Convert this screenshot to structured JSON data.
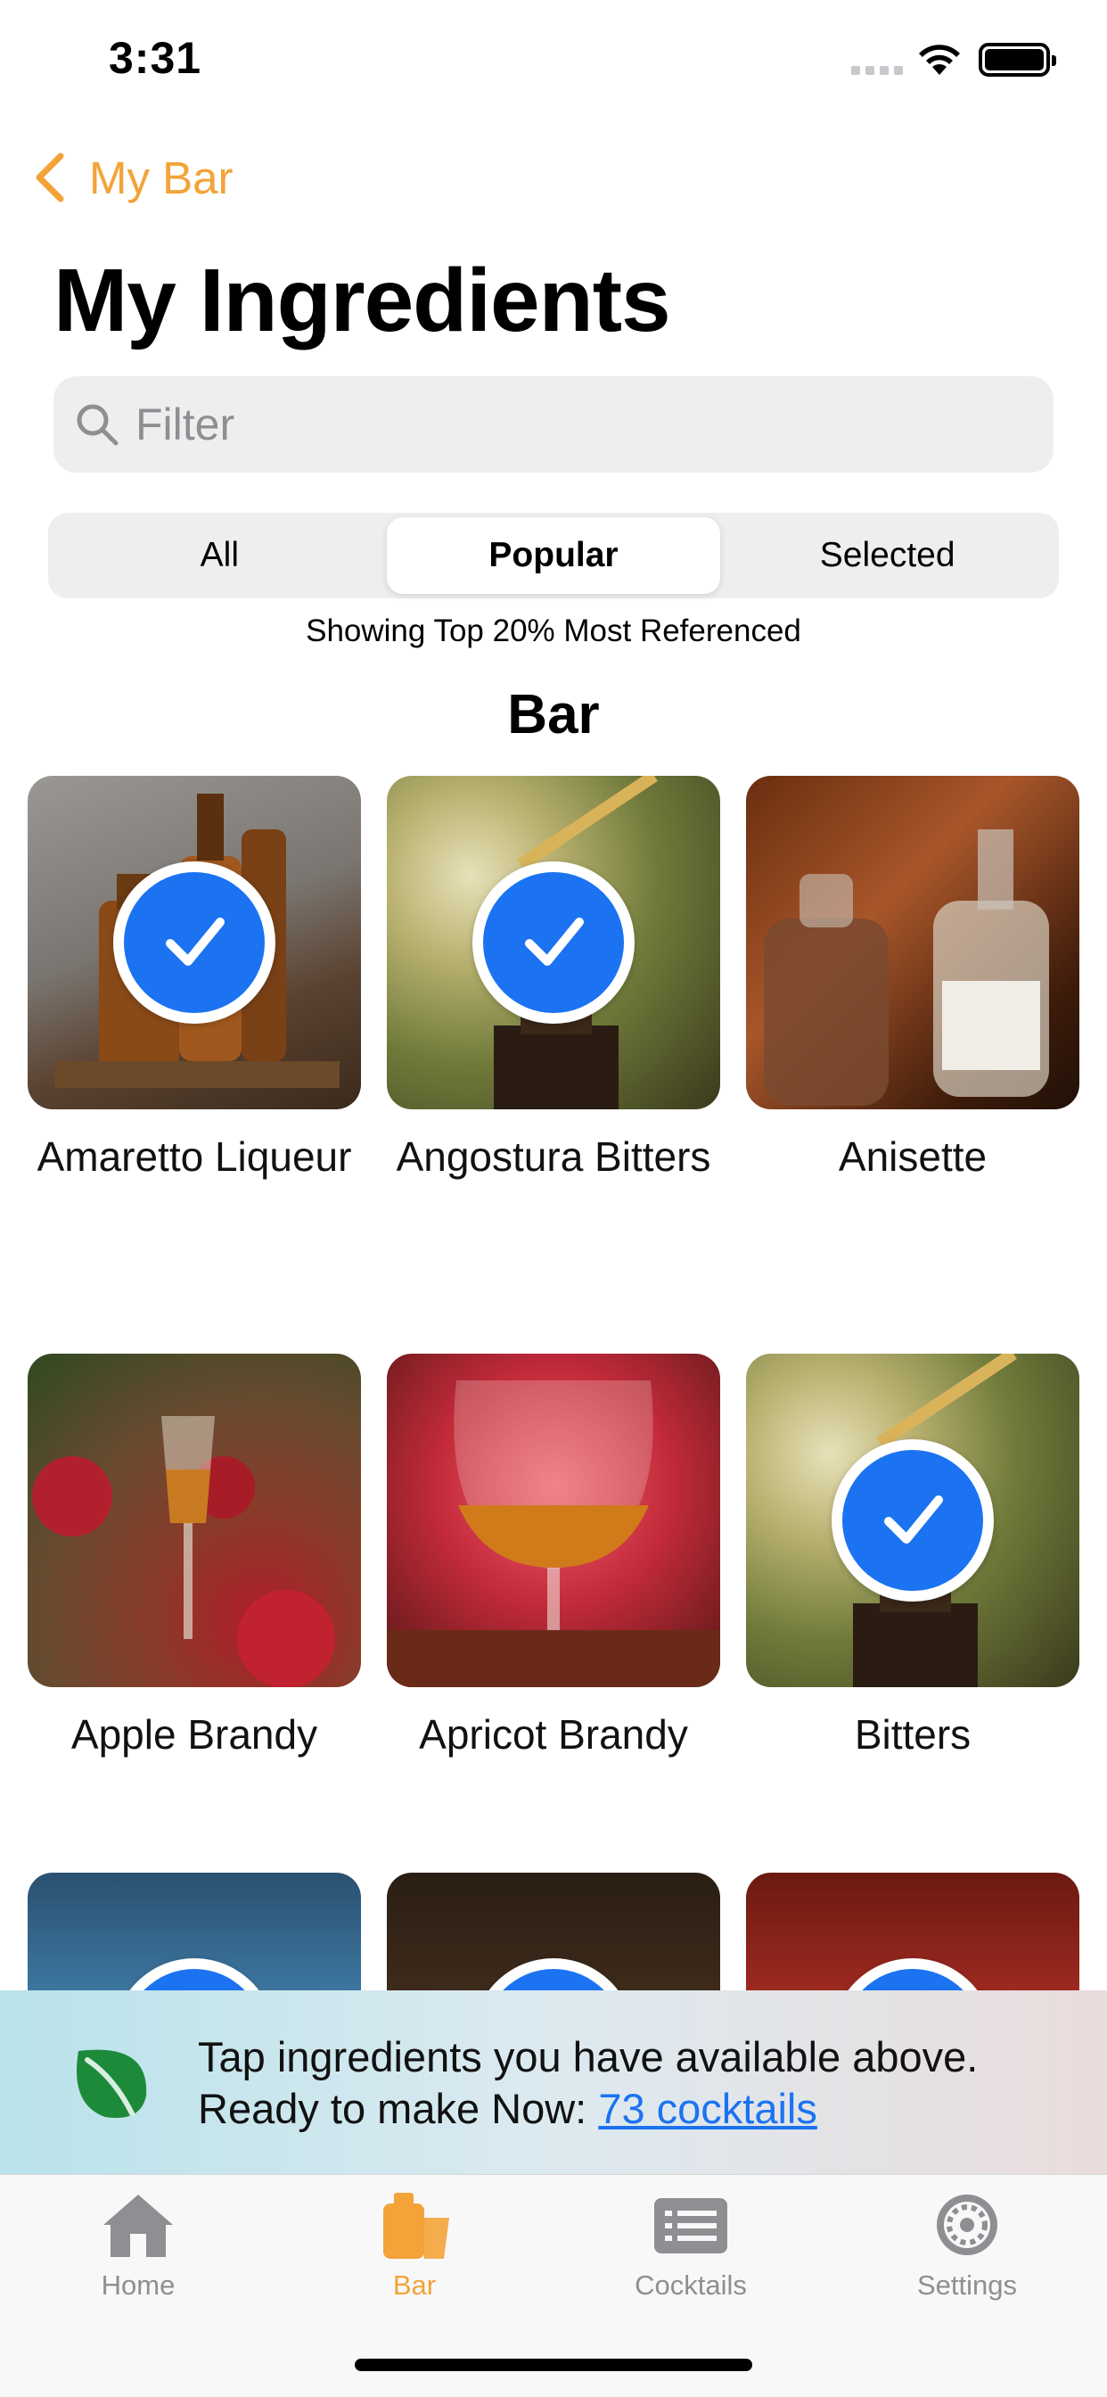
{
  "status": {
    "time": "3:31"
  },
  "nav": {
    "back_label": "My Bar",
    "title": "My Ingredients"
  },
  "search": {
    "placeholder": "Filter"
  },
  "segments": [
    {
      "label": "All",
      "selected": false
    },
    {
      "label": "Popular",
      "selected": true
    },
    {
      "label": "Selected",
      "selected": false
    }
  ],
  "showing_text": "Showing Top 20% Most Referenced",
  "section_title": "Bar",
  "ingredients": [
    {
      "name": "Amaretto Liqueur",
      "checked": true
    },
    {
      "name": "Angostura Bitters",
      "checked": true
    },
    {
      "name": "Anisette",
      "checked": false
    },
    {
      "name": "Apple Brandy",
      "checked": false
    },
    {
      "name": "Apricot Brandy",
      "checked": false
    },
    {
      "name": "Bitters",
      "checked": true
    }
  ],
  "banner": {
    "line1": "Tap ingredients you have available above.",
    "line2_prefix": "Ready to make Now: ",
    "link": "73 cocktails"
  },
  "tabbar": [
    {
      "label": "Home",
      "icon": "house-icon",
      "active": false
    },
    {
      "label": "Bar",
      "icon": "bar-icon",
      "active": true
    },
    {
      "label": "Cocktails",
      "icon": "list-icon",
      "active": false
    },
    {
      "label": "Settings",
      "icon": "gear-icon",
      "active": false
    }
  ],
  "colors": {
    "accent": "#f3a338",
    "check_blue": "#1b73f2",
    "link": "#1b73f2"
  }
}
